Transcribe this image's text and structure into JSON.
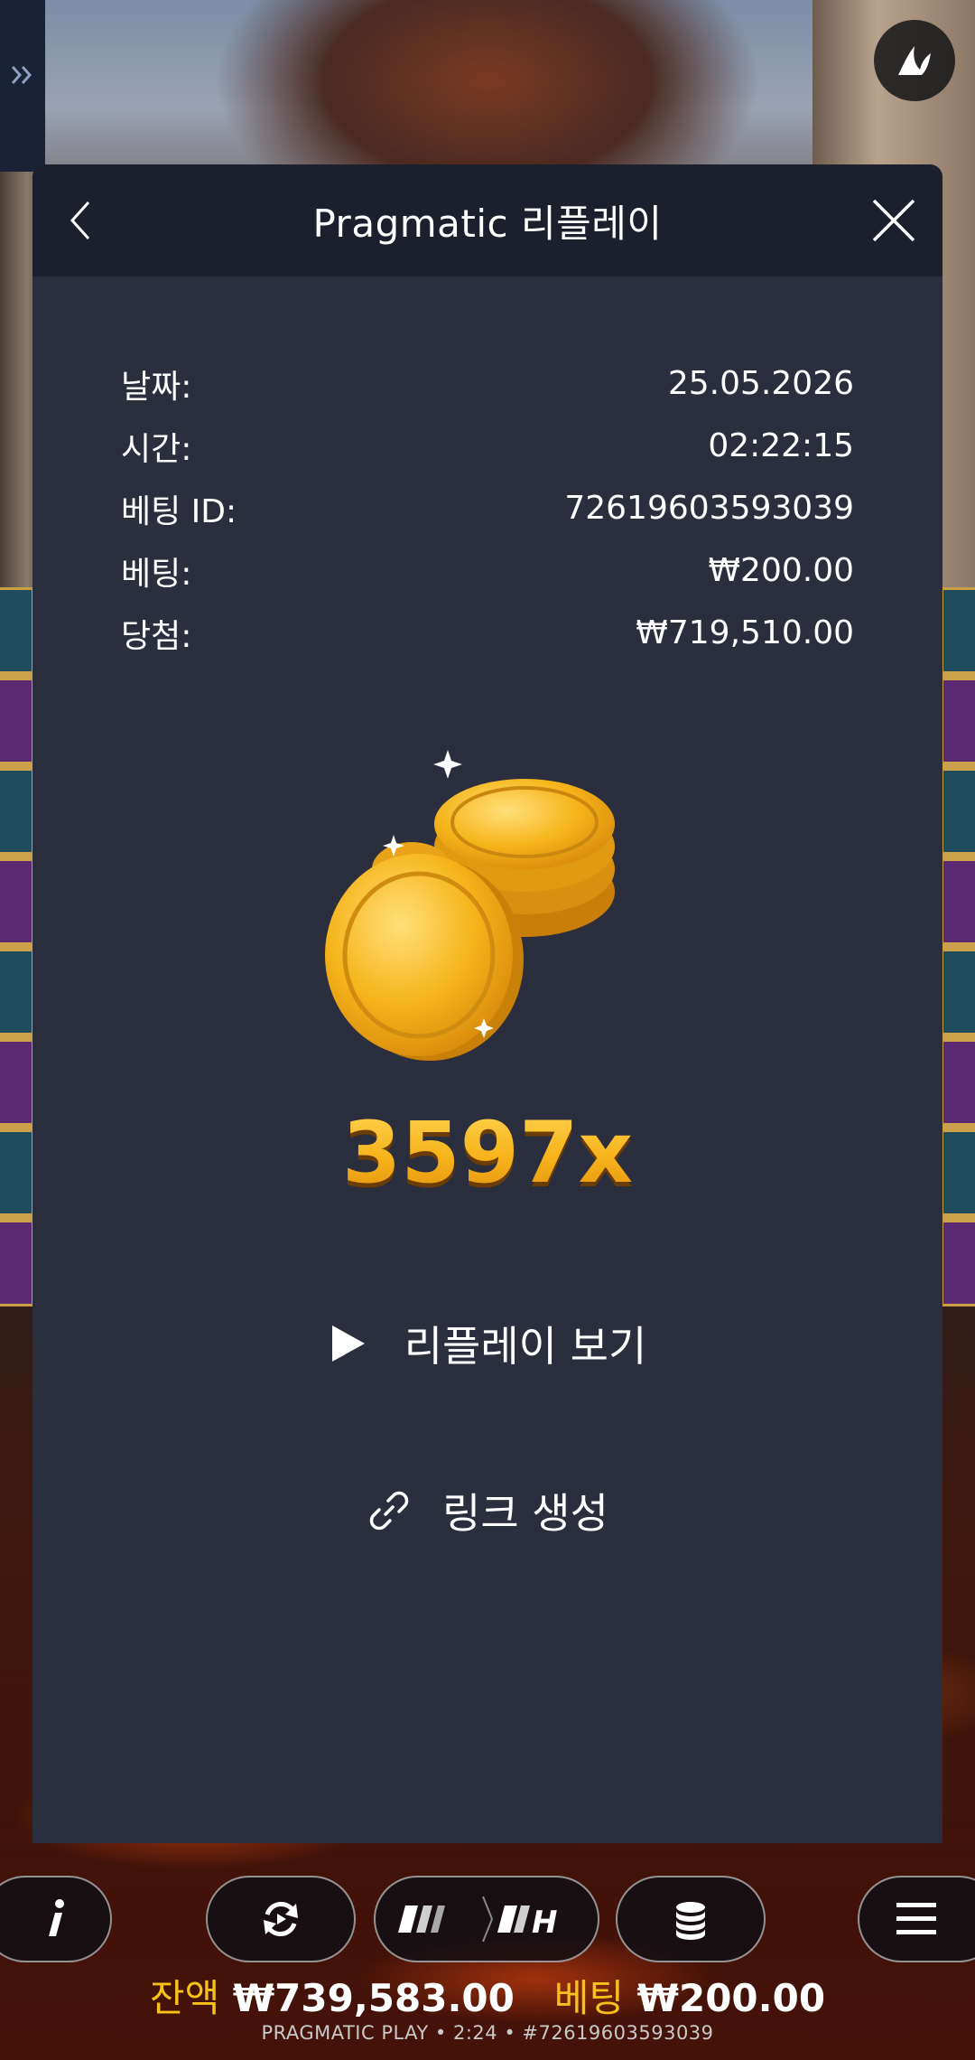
{
  "modal": {
    "title": "Pragmatic 리플레이",
    "info_rows": [
      {
        "label": "날짜:",
        "value": "25.05.2026"
      },
      {
        "label": "시간:",
        "value": "02:22:15"
      },
      {
        "label": "베팅 ID:",
        "value": "72619603593039"
      },
      {
        "label": "베팅:",
        "value": "₩200.00"
      },
      {
        "label": "당첨:",
        "value": "₩719,510.00"
      }
    ],
    "multiplier": "3597x",
    "replay_label": "리플레이 보기",
    "link_label": "링크 생성"
  },
  "bottom_bar": {
    "balance_label": "잔액",
    "balance_value": "₩739,583.00",
    "bet_label": "베팅",
    "bet_value": "₩200.00",
    "footer": "PRAGMATIC PLAY • 2:24 • #72619603593039"
  },
  "icons": {
    "back": "chevron-left-icon",
    "close": "close-icon",
    "play": "play-icon",
    "link": "link-icon",
    "info": "info-icon",
    "autoplay": "autoplay-icon",
    "speed": "speed-icon",
    "bet": "coins-stack-icon",
    "menu": "hamburger-menu-icon",
    "side": "double-chevron-right-icon",
    "logo": "pragmatic-logo-icon"
  },
  "colors": {
    "modal_bg": "#2b2e3d",
    "header_bg": "#1c1f2c",
    "multiplier": "#f6b118",
    "balance_label": "#f6c21a"
  }
}
